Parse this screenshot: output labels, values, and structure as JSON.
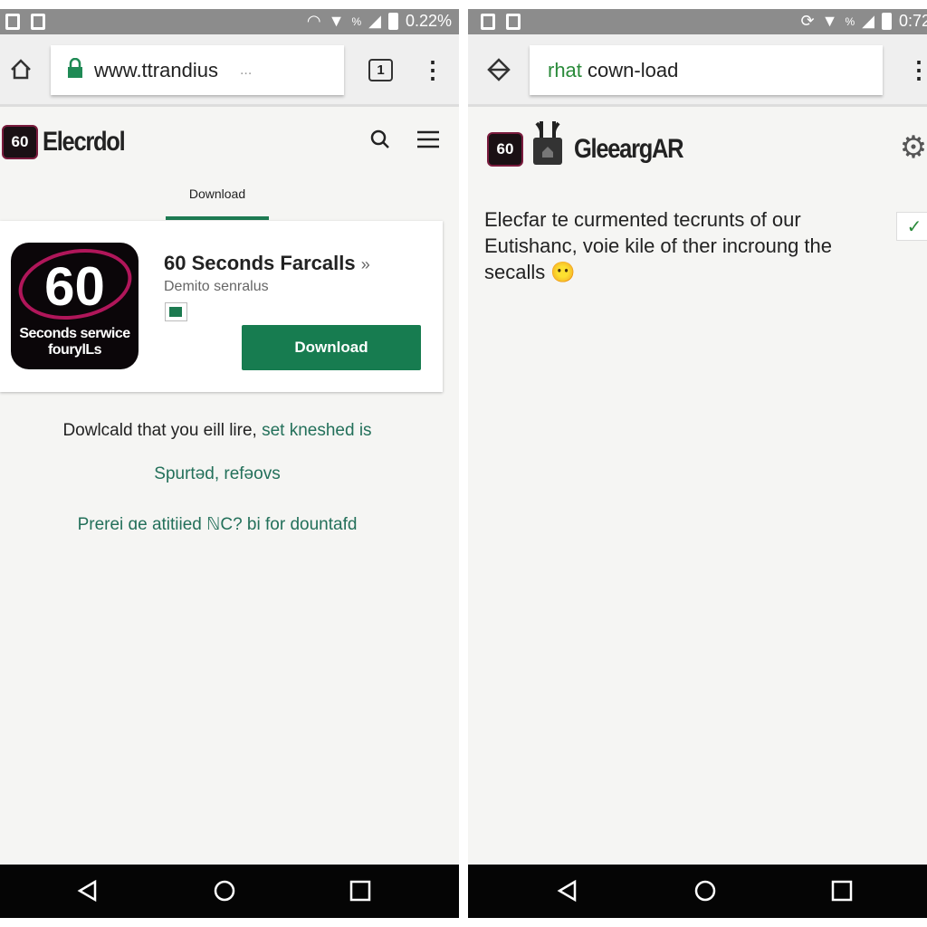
{
  "left": {
    "status": {
      "time": "0.22%",
      "signal_text": "%"
    },
    "url": {
      "text": "www.ttrandius",
      "ellipsis": "..."
    },
    "tabs_count": "1",
    "header": {
      "logo_text": "60",
      "brand": "Elecrdol"
    },
    "tab": {
      "label": "Download"
    },
    "app": {
      "icon_number": "60",
      "icon_sub1": "Seconds serwice",
      "icon_sub2": "fourylLs",
      "title": "60 Seconds Farcalls",
      "title_chevron": "»",
      "subtitle": "Demito senralus",
      "download_label": "Download"
    },
    "lines": {
      "l1a": "Dowlcald that you eill lire,",
      "l1b": " set kneshed is",
      "l2": "Spurtǝd, refǝovs",
      "l3": "Prerei ɑe atitiied ℕC? bi for dountafd"
    }
  },
  "right": {
    "status": {
      "time": "0:72",
      "signal_text": "%"
    },
    "search": {
      "green_part": "rhat",
      "rest": " cown-load"
    },
    "header": {
      "logo_text": "60",
      "brand": "GleeargAR"
    },
    "body": {
      "line1": "Elecfar te curmented tecrunts of our",
      "line2": "Eutishanc, voie kile of ther incroung the",
      "line3": "secalls",
      "emoji": "😶"
    },
    "check": "✓"
  },
  "colors": {
    "accent": "#177c50",
    "status_bar": "#8c8c8c",
    "nav_bar": "#050505"
  }
}
